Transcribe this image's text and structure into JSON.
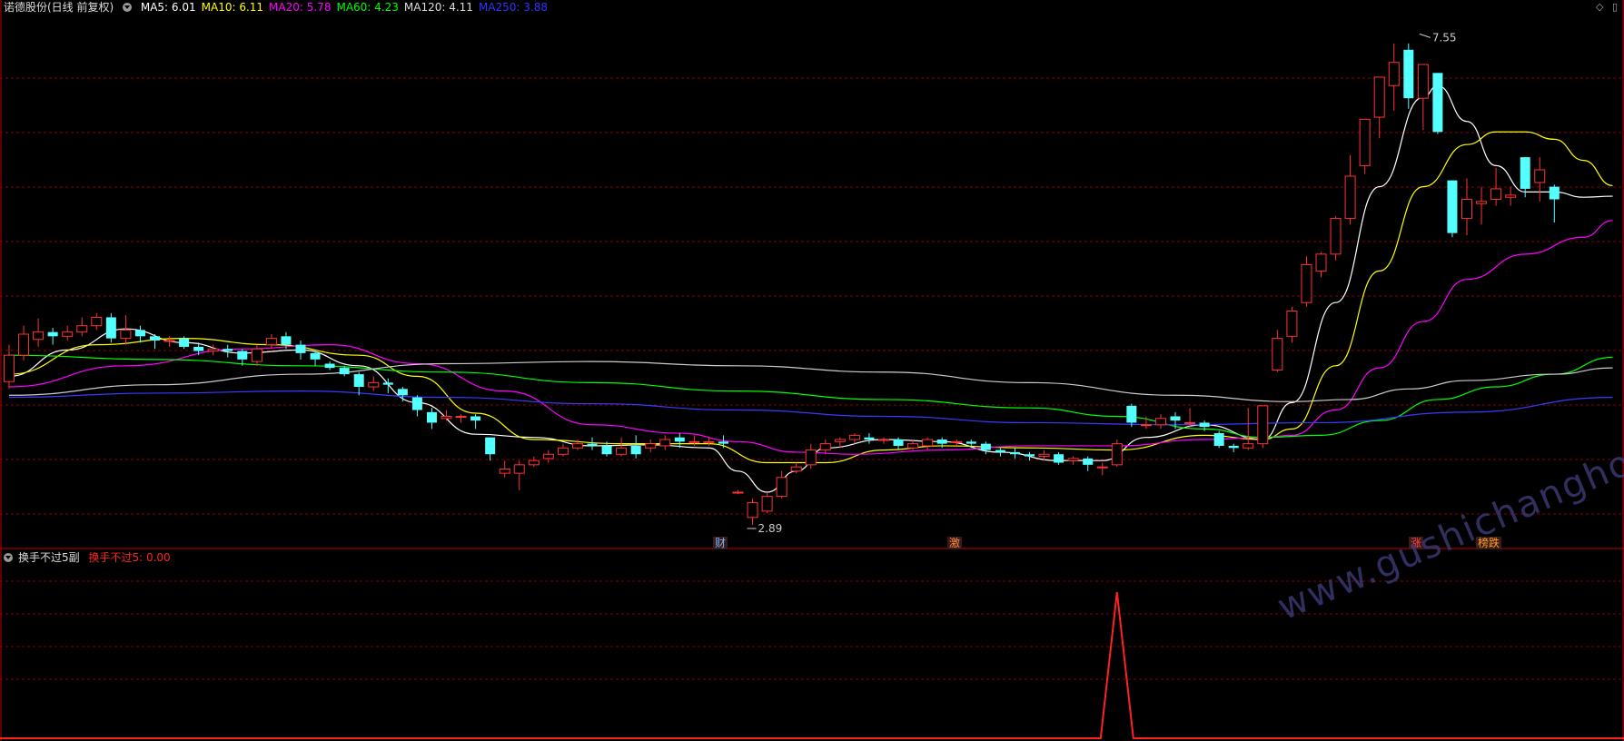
{
  "main_panel": {
    "title": "诺德股份(日线 前复权)",
    "ma_labels": [
      {
        "text": "MA5: 6.01",
        "color": "#ffffff"
      },
      {
        "text": "MA10: 6.11",
        "color": "#ffff00"
      },
      {
        "text": "MA20: 5.78",
        "color": "#ff00ff"
      },
      {
        "text": "MA60: 4.23",
        "color": "#00ff00"
      },
      {
        "text": "MA120: 4.11",
        "color": "#dddddd"
      },
      {
        "text": "MA250: 3.88",
        "color": "#3333ff"
      }
    ],
    "high_label": "7.55",
    "low_label": "2.89",
    "event_tags": [
      {
        "text": "财",
        "color": "#6fb4ff"
      },
      {
        "text": "激",
        "color": "#ff8c3c"
      },
      {
        "text": "涨",
        "color": "#ff4444"
      },
      {
        "text": "榜跌",
        "color": "#ffa020"
      }
    ]
  },
  "sub_panel": {
    "title": "换手不过5副",
    "indicator_label": "换手不过5: 0.00",
    "indicator_color": "#ff2222"
  },
  "watermark": "www.gushichanghong.com",
  "colors": {
    "up": "#ff3333",
    "down": "#54ffff",
    "grid": "#8b0000",
    "border": "#c00000"
  },
  "chart_data": {
    "type": "candlestick",
    "price_range": [
      2.7,
      7.7
    ],
    "high": 7.55,
    "low": 2.89,
    "candles": [
      [
        4.25,
        4.5,
        4.18,
        4.6
      ],
      [
        4.5,
        4.7,
        4.45,
        4.78
      ],
      [
        4.65,
        4.72,
        4.58,
        4.85
      ],
      [
        4.72,
        4.68,
        4.6,
        4.76
      ],
      [
        4.68,
        4.72,
        4.64,
        4.78
      ],
      [
        4.72,
        4.78,
        4.68,
        4.86
      ],
      [
        4.78,
        4.86,
        4.74,
        4.9
      ],
      [
        4.86,
        4.66,
        4.62,
        4.9
      ],
      [
        4.66,
        4.74,
        4.6,
        4.88
      ],
      [
        4.74,
        4.68,
        4.62,
        4.78
      ],
      [
        4.68,
        4.64,
        4.56,
        4.7
      ],
      [
        4.64,
        4.64,
        4.58,
        4.68
      ],
      [
        4.66,
        4.58,
        4.56,
        4.68
      ],
      [
        4.58,
        4.54,
        4.5,
        4.62
      ],
      [
        4.54,
        4.56,
        4.5,
        4.6
      ],
      [
        4.56,
        4.54,
        4.48,
        4.6
      ],
      [
        4.54,
        4.46,
        4.4,
        4.56
      ],
      [
        4.44,
        4.56,
        4.4,
        4.6
      ],
      [
        4.6,
        4.66,
        4.56,
        4.7
      ],
      [
        4.68,
        4.6,
        4.56,
        4.72
      ],
      [
        4.6,
        4.52,
        4.46,
        4.64
      ],
      [
        4.52,
        4.46,
        4.4,
        4.54
      ],
      [
        4.42,
        4.38,
        4.36,
        4.44
      ],
      [
        4.38,
        4.32,
        4.3,
        4.4
      ],
      [
        4.32,
        4.2,
        4.12,
        4.34
      ],
      [
        4.2,
        4.24,
        4.16,
        4.3
      ],
      [
        4.24,
        4.22,
        4.14,
        4.28
      ],
      [
        4.18,
        4.12,
        4.06,
        4.2
      ],
      [
        4.1,
        3.98,
        3.92,
        4.12
      ],
      [
        3.96,
        3.86,
        3.8,
        4.0
      ],
      [
        3.9,
        3.92,
        3.88,
        3.98
      ],
      [
        3.92,
        3.92,
        3.86,
        3.94
      ],
      [
        3.92,
        3.88,
        3.8,
        3.94
      ],
      [
        3.72,
        3.56,
        3.5,
        3.72
      ],
      [
        3.38,
        3.42,
        3.34,
        3.5
      ],
      [
        3.38,
        3.46,
        3.22,
        3.5
      ],
      [
        3.46,
        3.5,
        3.44,
        3.54
      ],
      [
        3.52,
        3.56,
        3.48,
        3.6
      ],
      [
        3.56,
        3.62,
        3.54,
        3.66
      ],
      [
        3.62,
        3.66,
        3.6,
        3.7
      ],
      [
        3.66,
        3.64,
        3.6,
        3.72
      ],
      [
        3.64,
        3.56,
        3.54,
        3.68
      ],
      [
        3.56,
        3.62,
        3.54,
        3.72
      ],
      [
        3.64,
        3.56,
        3.52,
        3.74
      ],
      [
        3.62,
        3.66,
        3.58,
        3.7
      ],
      [
        3.64,
        3.7,
        3.6,
        3.74
      ],
      [
        3.72,
        3.68,
        3.62,
        3.76
      ],
      [
        3.68,
        3.68,
        3.64,
        3.74
      ],
      [
        3.68,
        3.68,
        3.64,
        3.72
      ],
      [
        3.68,
        3.66,
        3.62,
        3.74
      ],
      [
        3.2,
        3.2,
        3.18,
        3.22
      ],
      [
        2.96,
        3.1,
        2.89,
        3.14
      ],
      [
        3.02,
        3.16,
        3.0,
        3.2
      ],
      [
        3.16,
        3.34,
        3.14,
        3.4
      ],
      [
        3.4,
        3.44,
        3.38,
        3.48
      ],
      [
        3.46,
        3.6,
        3.42,
        3.66
      ],
      [
        3.6,
        3.66,
        3.56,
        3.7
      ],
      [
        3.68,
        3.7,
        3.62,
        3.72
      ],
      [
        3.7,
        3.74,
        3.66,
        3.76
      ],
      [
        3.72,
        3.7,
        3.66,
        3.76
      ],
      [
        3.7,
        3.7,
        3.66,
        3.72
      ],
      [
        3.7,
        3.64,
        3.6,
        3.72
      ],
      [
        3.62,
        3.66,
        3.6,
        3.7
      ],
      [
        3.64,
        3.7,
        3.6,
        3.72
      ],
      [
        3.7,
        3.66,
        3.62,
        3.72
      ],
      [
        3.68,
        3.68,
        3.64,
        3.7
      ],
      [
        3.68,
        3.66,
        3.62,
        3.7
      ],
      [
        3.66,
        3.6,
        3.56,
        3.68
      ],
      [
        3.6,
        3.58,
        3.54,
        3.62
      ],
      [
        3.58,
        3.56,
        3.52,
        3.62
      ],
      [
        3.56,
        3.54,
        3.5,
        3.58
      ],
      [
        3.54,
        3.56,
        3.5,
        3.6
      ],
      [
        3.56,
        3.48,
        3.46,
        3.58
      ],
      [
        3.5,
        3.52,
        3.46,
        3.54
      ],
      [
        3.52,
        3.46,
        3.4,
        3.54
      ],
      [
        3.44,
        3.44,
        3.36,
        3.48
      ],
      [
        3.46,
        3.66,
        3.44,
        3.7
      ],
      [
        4.02,
        3.86,
        3.82,
        4.04
      ],
      [
        3.84,
        3.84,
        3.8,
        3.92
      ],
      [
        3.84,
        3.9,
        3.8,
        3.94
      ],
      [
        3.92,
        3.88,
        3.8,
        3.96
      ],
      [
        3.86,
        3.86,
        3.8,
        4.0
      ],
      [
        3.86,
        3.82,
        3.78,
        3.88
      ],
      [
        3.76,
        3.64,
        3.62,
        3.78
      ],
      [
        3.64,
        3.62,
        3.58,
        3.66
      ],
      [
        3.62,
        3.66,
        3.6,
        4.0
      ],
      [
        3.66,
        4.02,
        3.62,
        4.02
      ],
      [
        4.36,
        4.66,
        4.34,
        4.74
      ],
      [
        4.68,
        4.92,
        4.62,
        4.96
      ],
      [
        5.0,
        5.36,
        4.96,
        5.44
      ],
      [
        5.3,
        5.46,
        5.24,
        5.48
      ],
      [
        5.46,
        5.8,
        5.4,
        5.82
      ],
      [
        5.8,
        6.2,
        5.74,
        6.4
      ],
      [
        6.3,
        6.74,
        6.22,
        6.74
      ],
      [
        6.76,
        7.14,
        6.56,
        7.14
      ],
      [
        7.06,
        7.28,
        6.82,
        7.46
      ],
      [
        7.4,
        6.94,
        6.84,
        7.46
      ],
      [
        6.94,
        7.26,
        6.64,
        7.26
      ],
      [
        7.18,
        6.62,
        6.6,
        7.18
      ],
      [
        6.16,
        5.66,
        5.62,
        6.16
      ],
      [
        5.8,
        5.98,
        5.64,
        6.18
      ],
      [
        5.94,
        5.96,
        5.74,
        6.1
      ],
      [
        5.98,
        6.08,
        5.92,
        6.28
      ],
      [
        6.0,
        6.02,
        5.92,
        6.1
      ],
      [
        6.38,
        6.08,
        6.0,
        6.38
      ],
      [
        6.14,
        6.26,
        5.96,
        6.38
      ],
      [
        6.1,
        5.98,
        5.76,
        6.12
      ]
    ],
    "ma_series": [
      {
        "name": "MA5",
        "color": "#ffffff",
        "points": [
          [
            0,
            4.3
          ],
          [
            4,
            4.55
          ],
          [
            8,
            4.75
          ],
          [
            12,
            4.62
          ],
          [
            16,
            4.52
          ],
          [
            20,
            4.55
          ],
          [
            24,
            4.4
          ],
          [
            28,
            4.05
          ],
          [
            32,
            3.75
          ],
          [
            36,
            3.72
          ],
          [
            40,
            3.64
          ],
          [
            44,
            3.65
          ],
          [
            48,
            3.62
          ],
          [
            50,
            3.4
          ],
          [
            52,
            3.2
          ],
          [
            54,
            3.4
          ],
          [
            56,
            3.62
          ],
          [
            60,
            3.7
          ],
          [
            64,
            3.68
          ],
          [
            68,
            3.58
          ],
          [
            72,
            3.5
          ],
          [
            75,
            3.5
          ],
          [
            78,
            3.72
          ],
          [
            82,
            3.84
          ],
          [
            86,
            3.7
          ],
          [
            88,
            4.05
          ],
          [
            91,
            5.0
          ],
          [
            94,
            6.1
          ],
          [
            97,
            6.95
          ],
          [
            98,
            7.06
          ],
          [
            100,
            6.72
          ],
          [
            102,
            6.3
          ],
          [
            104,
            6.05
          ],
          [
            106,
            6.05
          ],
          [
            108,
            6.0
          ],
          [
            110,
            6.01
          ]
        ]
      },
      {
        "name": "MA10",
        "color": "#ffff00",
        "points": [
          [
            0,
            4.32
          ],
          [
            6,
            4.6
          ],
          [
            12,
            4.66
          ],
          [
            18,
            4.6
          ],
          [
            24,
            4.5
          ],
          [
            28,
            4.3
          ],
          [
            32,
            3.95
          ],
          [
            36,
            3.7
          ],
          [
            42,
            3.66
          ],
          [
            48,
            3.66
          ],
          [
            52,
            3.48
          ],
          [
            56,
            3.48
          ],
          [
            60,
            3.6
          ],
          [
            64,
            3.64
          ],
          [
            70,
            3.62
          ],
          [
            76,
            3.6
          ],
          [
            82,
            3.74
          ],
          [
            86,
            3.7
          ],
          [
            88,
            3.8
          ],
          [
            91,
            4.4
          ],
          [
            94,
            5.3
          ],
          [
            97,
            6.1
          ],
          [
            100,
            6.5
          ],
          [
            102,
            6.62
          ],
          [
            104,
            6.62
          ],
          [
            106,
            6.55
          ],
          [
            108,
            6.35
          ],
          [
            110,
            6.11
          ]
        ]
      },
      {
        "name": "MA20",
        "color": "#ff00ff",
        "points": [
          [
            0,
            4.2
          ],
          [
            8,
            4.4
          ],
          [
            16,
            4.56
          ],
          [
            22,
            4.6
          ],
          [
            28,
            4.42
          ],
          [
            34,
            4.16
          ],
          [
            40,
            3.84
          ],
          [
            46,
            3.76
          ],
          [
            50,
            3.68
          ],
          [
            54,
            3.58
          ],
          [
            58,
            3.56
          ],
          [
            64,
            3.6
          ],
          [
            70,
            3.64
          ],
          [
            76,
            3.64
          ],
          [
            82,
            3.7
          ],
          [
            86,
            3.72
          ],
          [
            88,
            3.74
          ],
          [
            91,
            3.98
          ],
          [
            94,
            4.38
          ],
          [
            97,
            4.82
          ],
          [
            100,
            5.22
          ],
          [
            104,
            5.46
          ],
          [
            108,
            5.62
          ],
          [
            110,
            5.78
          ]
        ]
      },
      {
        "name": "MA60",
        "color": "#00ff00",
        "points": [
          [
            0,
            4.5
          ],
          [
            10,
            4.46
          ],
          [
            20,
            4.4
          ],
          [
            30,
            4.34
          ],
          [
            40,
            4.24
          ],
          [
            50,
            4.16
          ],
          [
            60,
            4.08
          ],
          [
            70,
            4.0
          ],
          [
            76,
            3.92
          ],
          [
            82,
            3.8
          ],
          [
            86,
            3.72
          ],
          [
            90,
            3.74
          ],
          [
            94,
            3.88
          ],
          [
            98,
            4.08
          ],
          [
            102,
            4.2
          ],
          [
            106,
            4.32
          ],
          [
            110,
            4.48
          ]
        ]
      },
      {
        "name": "MA120",
        "color": "#cccccc",
        "points": [
          [
            0,
            4.12
          ],
          [
            10,
            4.22
          ],
          [
            20,
            4.32
          ],
          [
            30,
            4.42
          ],
          [
            40,
            4.44
          ],
          [
            50,
            4.4
          ],
          [
            60,
            4.34
          ],
          [
            70,
            4.24
          ],
          [
            80,
            4.12
          ],
          [
            88,
            4.06
          ],
          [
            92,
            4.08
          ],
          [
            96,
            4.18
          ],
          [
            100,
            4.26
          ],
          [
            106,
            4.32
          ],
          [
            110,
            4.38
          ]
        ]
      },
      {
        "name": "MA250",
        "color": "#3a3aff",
        "points": [
          [
            0,
            4.1
          ],
          [
            10,
            4.14
          ],
          [
            20,
            4.16
          ],
          [
            30,
            4.1
          ],
          [
            40,
            4.04
          ],
          [
            50,
            3.98
          ],
          [
            60,
            3.92
          ],
          [
            70,
            3.86
          ],
          [
            80,
            3.84
          ],
          [
            90,
            3.86
          ],
          [
            100,
            3.96
          ],
          [
            110,
            4.1
          ]
        ]
      }
    ],
    "sub_indicator": {
      "name": "换手不过5",
      "type": "line",
      "spike_index": 76,
      "spike_value": 1,
      "ylim": [
        0,
        1.2
      ]
    }
  }
}
